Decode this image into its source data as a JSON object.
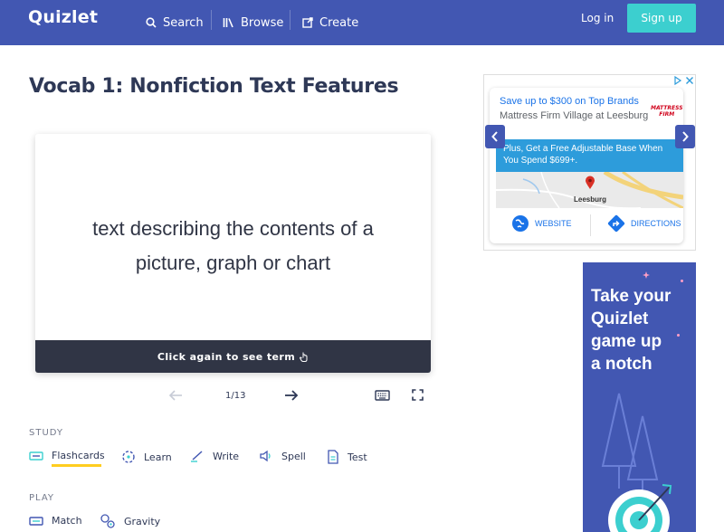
{
  "header": {
    "logo": "Quizlet",
    "nav": {
      "search": "Search",
      "browse": "Browse",
      "create": "Create"
    },
    "login": "Log in",
    "signup": "Sign up"
  },
  "set_title": "Vocab 1: Nonfiction Text Features",
  "flashcard": {
    "text_line1": "text describing the contents of a",
    "text_line2": "picture, graph or chart",
    "footer": "Click again to see term",
    "counter": "1/13"
  },
  "study": {
    "label": "STUDY",
    "modes": [
      "Flashcards",
      "Learn",
      "Write",
      "Spell",
      "Test"
    ]
  },
  "play": {
    "label": "PLAY",
    "modes": [
      "Match",
      "Gravity"
    ]
  },
  "ad_store": {
    "headline": "Save up to $300 on Top Brands",
    "subline": "Mattress Firm Village at Leesburg",
    "brand_line1": "MATTRESS",
    "brand_line2": "FIRM",
    "promo_line1": "Plus, Get a Free Adjustable Base When",
    "promo_line2": "You Spend $699+.",
    "map_label": "Leesburg",
    "website": "WEBSITE",
    "directions": "DIRECTIONS"
  },
  "ad_quizlet": {
    "line1": "Take your",
    "line2": "Quizlet",
    "line3": "game up",
    "line4": "a notch"
  },
  "colors": {
    "brand": "#4257b2",
    "accent": "#3ccfcf",
    "highlight": "#ffcd1f",
    "dark": "#303545"
  }
}
